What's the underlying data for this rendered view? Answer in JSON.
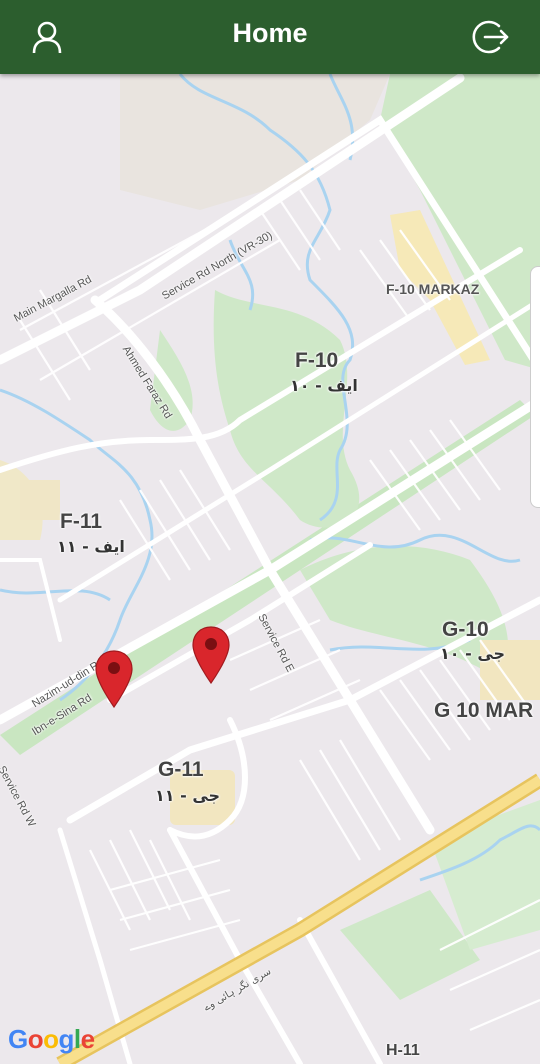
{
  "header": {
    "title": "Home",
    "left_icon": "user-profile-icon",
    "right_icon": "logout-icon",
    "background": "#2c5e2e"
  },
  "map": {
    "sectors": {
      "f10": {
        "name": "F-10",
        "urdu": "ایف - ۱۰"
      },
      "f11": {
        "name": "F-11",
        "urdu": "ایف - ۱۱"
      },
      "g10": {
        "name": "G-10",
        "urdu": "جی - ۱۰"
      },
      "g11": {
        "name": "G-11",
        "urdu": "جی - ۱۱"
      },
      "h11": {
        "name": "H-11"
      }
    },
    "markaz": {
      "f10_markaz": "F-10 MARKAZ",
      "g10_markaz": "G 10 MAR"
    },
    "roads": {
      "main_margalla": "Main Margalla Rd",
      "service_north": "Service Rd North (VR-30)",
      "ahmed_faraz": "Ahmed Faraz Rd",
      "nazim_ud_din": "Nazim-ud-din Rd",
      "ibn_e_sina": "Ibn-e-Sina Rd",
      "service_e": "Service Rd E",
      "service_w": "Service Rd W",
      "srinagar": "سری نگر ہائی وے"
    },
    "markers": [
      "map-marker",
      "map-marker"
    ],
    "attribution": "Google",
    "colors": {
      "land": "#ece8ec",
      "park": "#c9e8c2",
      "water": "#a9d3f0",
      "highway": "#f5d87a",
      "marker": "#d9262c"
    }
  }
}
